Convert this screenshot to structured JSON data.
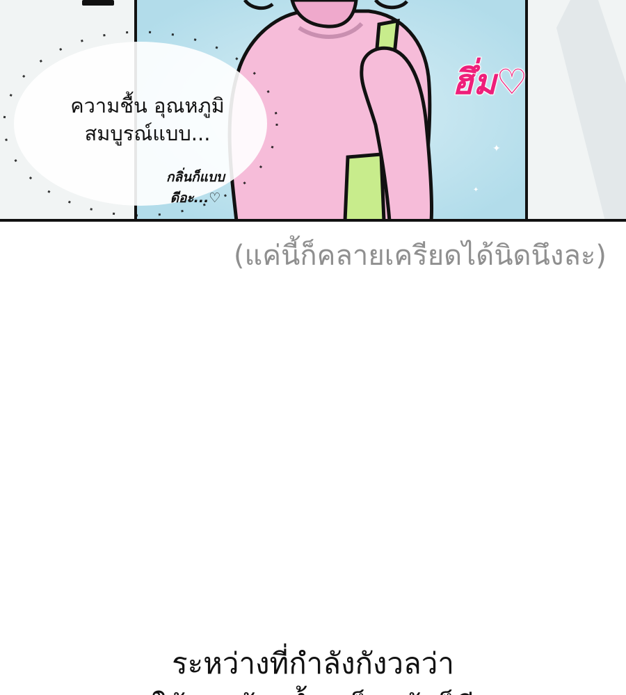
{
  "panel": {
    "thought_bubble": {
      "line1": "ความชื้น อุณหภูมิ",
      "line2": "สมบูรณ์แบบ..."
    },
    "smell_remark": {
      "line1": "กลิ่นก็แบบ",
      "line2": "ดีอะ...♡"
    },
    "sound_effect": "ฮึ่ม♡",
    "colors": {
      "sky": "#bfe3ee",
      "character_skin": "#f6bcd9",
      "strap": "#c8ec8c",
      "sound_effect": "#ee1f7a",
      "outline": "#111111"
    }
  },
  "aside_caption": "(แค่นี้ก็คลายเครียดได้นิดนึงละ)",
  "narration": {
    "line1": "ระหว่างที่กำลังกังวลว่า",
    "line2": "ใช้งานห้องน้ำเสร็จแล้วก็ดี"
  }
}
